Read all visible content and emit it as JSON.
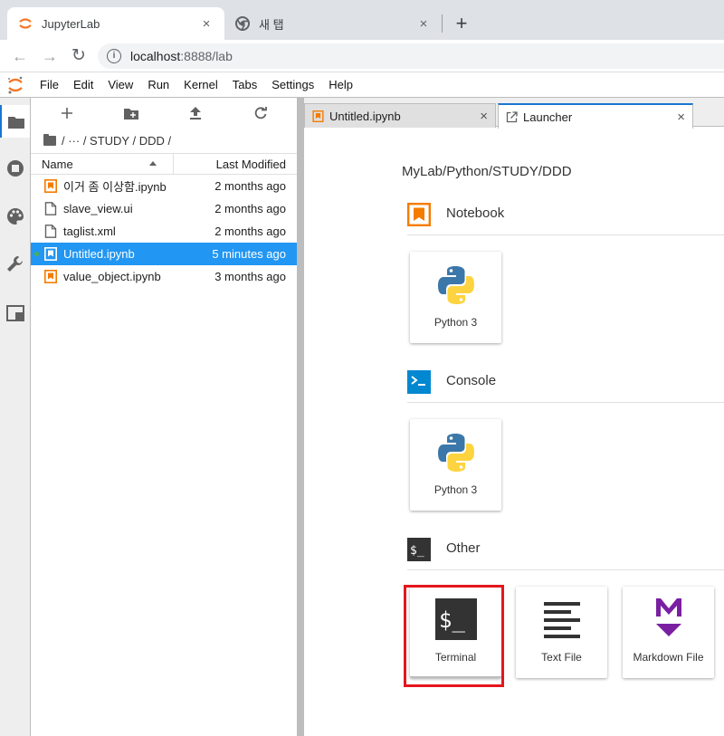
{
  "browser": {
    "tabs": [
      {
        "title": "JupyterLab",
        "close": "×"
      },
      {
        "title": "새 탭",
        "close": "×"
      }
    ],
    "new_tab": "+",
    "nav": {
      "back": "←",
      "forward": "→",
      "reload": "↻"
    },
    "url_host": "localhost",
    "url_path": ":8888/lab",
    "info_glyph": "i"
  },
  "menu": [
    "File",
    "Edit",
    "View",
    "Run",
    "Kernel",
    "Tabs",
    "Settings",
    "Help"
  ],
  "activity_icons": [
    "folder-icon",
    "running-icon",
    "palette-icon",
    "wrench-icon",
    "tabs-icon"
  ],
  "filebrowser": {
    "breadcrumb": "/ ··· / STUDY / DDD /",
    "header": {
      "name": "Name",
      "modified": "Last Modified"
    },
    "files": [
      {
        "name": "이거 좀 이상함.ipynb",
        "modified": "2 months ago",
        "type": "notebook",
        "selected": false
      },
      {
        "name": "slave_view.ui",
        "modified": "2 months ago",
        "type": "file",
        "selected": false
      },
      {
        "name": "taglist.xml",
        "modified": "2 months ago",
        "type": "file",
        "selected": false
      },
      {
        "name": "Untitled.ipynb",
        "modified": "5 minutes ago",
        "type": "notebook",
        "selected": true
      },
      {
        "name": "value_object.ipynb",
        "modified": "3 months ago",
        "type": "notebook",
        "selected": false
      }
    ]
  },
  "doc_tabs": [
    {
      "title": "Untitled.ipynb",
      "close": "×"
    },
    {
      "title": "Launcher",
      "close": "×"
    }
  ],
  "launcher": {
    "path": "MyLab/Python/STUDY/DDD",
    "sections": {
      "notebook": {
        "title": "Notebook",
        "cards": [
          "Python 3"
        ]
      },
      "console": {
        "title": "Console",
        "cards": [
          "Python 3"
        ]
      },
      "other": {
        "title": "Other",
        "cards": [
          "Terminal",
          "Text File",
          "Markdown File"
        ]
      }
    }
  },
  "colors": {
    "accent": "#2196f3",
    "notebook_orange": "#f57c00",
    "console_blue": "#0288d1",
    "markdown_purple": "#7b1fa2",
    "highlight_red": "#e5161d"
  }
}
